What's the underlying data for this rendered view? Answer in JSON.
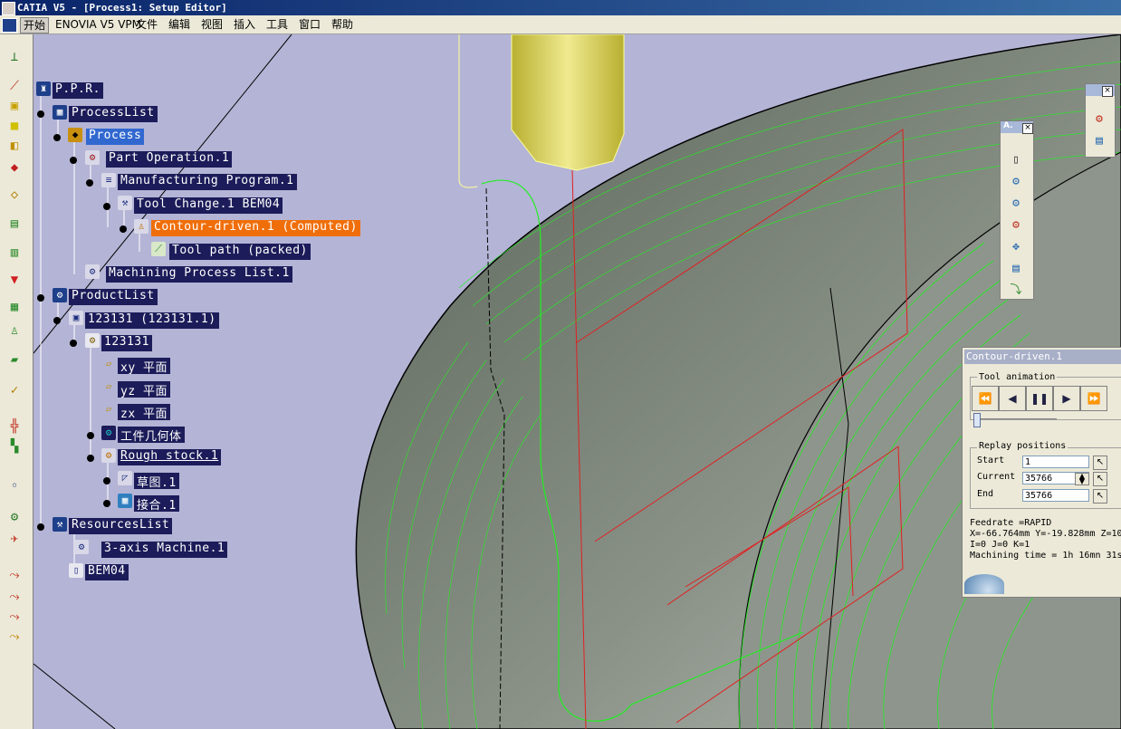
{
  "window": {
    "title": "CATIA V5 - [Process1: Setup Editor]"
  },
  "menu": [
    "开始",
    "ENOVIA V5 VPM",
    "文件",
    "编辑",
    "视图",
    "插入",
    "工具",
    "窗口",
    "帮助"
  ],
  "tree": [
    {
      "label": "P.P.R."
    },
    {
      "label": "ProcessList"
    },
    {
      "label": "Process"
    },
    {
      "label": "Part Operation.1"
    },
    {
      "label": "Manufacturing Program.1"
    },
    {
      "label": "Tool Change.1  BEM04"
    },
    {
      "label": "Contour-driven.1 (Computed)"
    },
    {
      "label": "Tool path (packed)"
    },
    {
      "label": "Machining Process List.1"
    },
    {
      "label": "ProductList"
    },
    {
      "label": "123131 (123131.1)"
    },
    {
      "label": "123131"
    },
    {
      "label": "xy 平面"
    },
    {
      "label": "yz 平面"
    },
    {
      "label": "zx 平面"
    },
    {
      "label": "工件几何体"
    },
    {
      "label": "Rough stock.1"
    },
    {
      "label": "草图.1"
    },
    {
      "label": "接合.1"
    },
    {
      "label": "ResourcesList"
    },
    {
      "label": "3-axis Machine.1"
    },
    {
      "label": "BEM04"
    }
  ],
  "dialog": {
    "title": "Contour-driven.1",
    "tool_animation_legend": "Tool animation",
    "replay_legend": "Replay positions",
    "start_label": "Start",
    "start_value": "1",
    "current_label": "Current",
    "current_value": "35766",
    "end_label": "End",
    "end_value": "35766",
    "feedrate": "Feedrate =RAPID",
    "coords": "X=-66.764mm Y=-19.828mm Z=10",
    "ijk": "I=0 J=0 K=1",
    "machining_time": "Machining time = 1h 16mn 31s"
  },
  "floating_toolbar_a": {
    "title": "A."
  },
  "colors": {
    "background": "#b4b4d6",
    "tree_node": "#1c1c5a",
    "selected": "#3168d0",
    "computed": "#f06e0a",
    "toolpath": "#22ee22",
    "tool": "#e8e070"
  }
}
